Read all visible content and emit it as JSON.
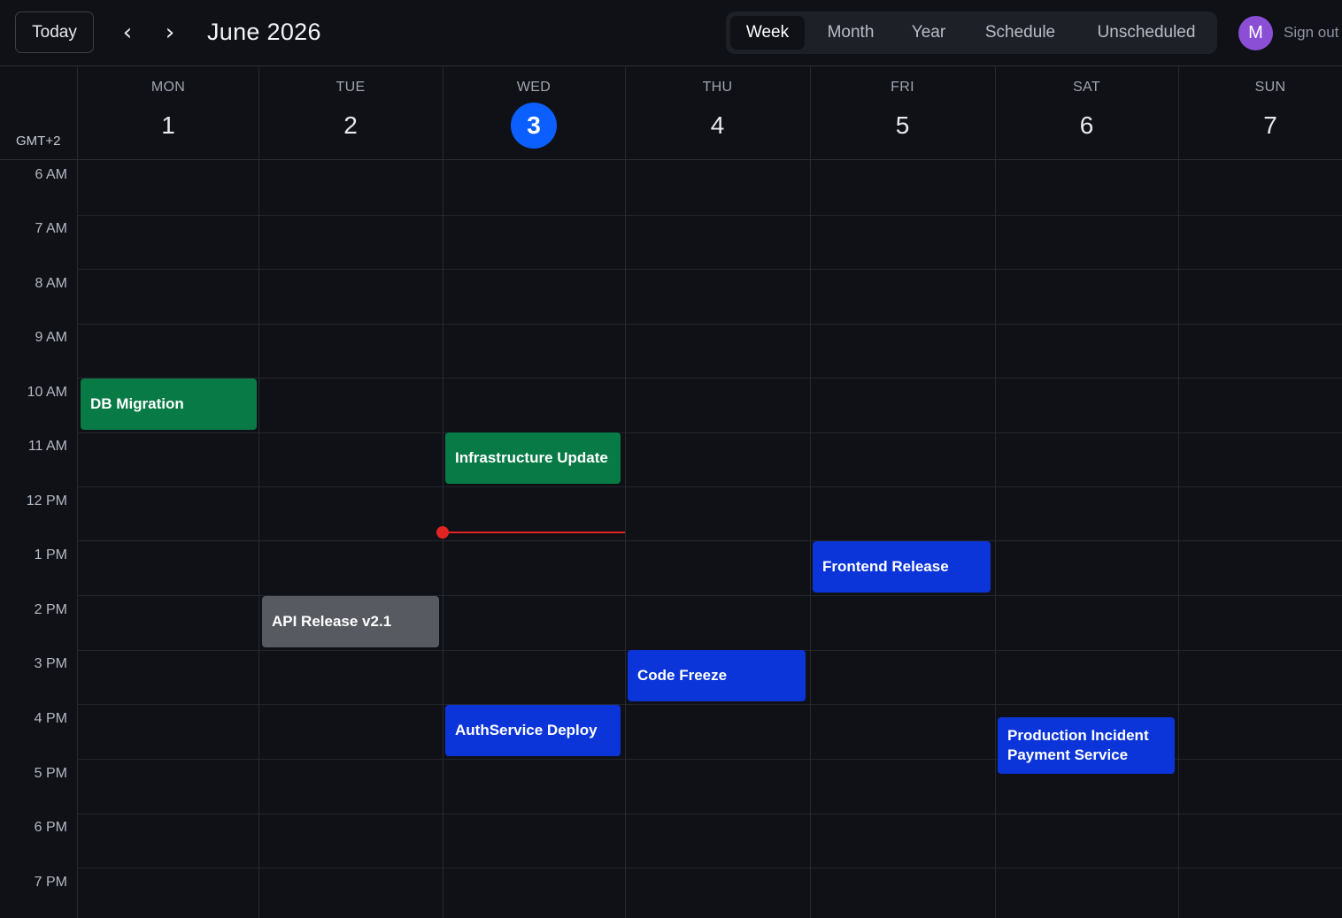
{
  "toolbar": {
    "today_label": "Today",
    "prev_label": "‹",
    "next_label": "›",
    "title": "June 2026",
    "views": [
      "Week",
      "Month",
      "Year",
      "Schedule",
      "Unscheduled"
    ],
    "active_view": "Week",
    "avatar_initial": "M",
    "sign_out_label": "Sign out"
  },
  "calendar": {
    "timezone": "GMT+2",
    "days": [
      {
        "name": "MON",
        "num": "1",
        "today": false
      },
      {
        "name": "TUE",
        "num": "2",
        "today": false
      },
      {
        "name": "WED",
        "num": "3",
        "today": true
      },
      {
        "name": "THU",
        "num": "4",
        "today": false
      },
      {
        "name": "FRI",
        "num": "5",
        "today": false
      },
      {
        "name": "SAT",
        "num": "6",
        "today": false
      },
      {
        "name": "SUN",
        "num": "7",
        "today": false
      }
    ],
    "hours": [
      "6 AM",
      "7 AM",
      "8 AM",
      "9 AM",
      "10 AM",
      "11 AM",
      "12 PM",
      "1 PM",
      "2 PM",
      "3 PM",
      "4 PM",
      "5 PM",
      "6 PM",
      "7 PM"
    ],
    "current_time_day": "WED",
    "events": [
      {
        "title": "DB Migration",
        "day": "MON",
        "start": "10:00",
        "end": "11:00",
        "color": "green"
      },
      {
        "title": "Infrastructure Update",
        "day": "WED",
        "start": "11:00",
        "end": "12:00",
        "color": "green"
      },
      {
        "title": "Frontend Release",
        "day": "FRI",
        "start": "13:00",
        "end": "14:00",
        "color": "blue"
      },
      {
        "title": "API Release v2.1",
        "day": "TUE",
        "start": "14:00",
        "end": "15:00",
        "color": "gray"
      },
      {
        "title": "Code Freeze",
        "day": "THU",
        "start": "15:00",
        "end": "16:00",
        "color": "blue"
      },
      {
        "title": "AuthService Deploy",
        "day": "WED",
        "start": "16:00",
        "end": "17:00",
        "color": "blue"
      },
      {
        "title": "Production Incident Payment Service",
        "day": "SAT",
        "start": "16:15",
        "end": "17:15",
        "color": "blue"
      }
    ]
  },
  "colors": {
    "accent": "#0b5fff",
    "green": "#087a45",
    "blue": "#0b35d9",
    "gray": "#585a62",
    "now": "#e02424"
  }
}
